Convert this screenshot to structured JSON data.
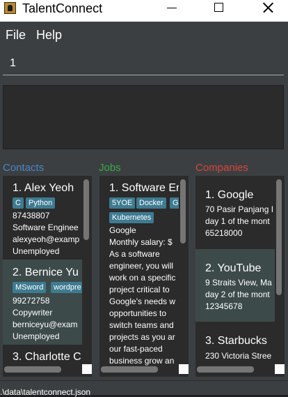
{
  "window": {
    "title": "TalentConnect",
    "controls": [
      "minimize-icon",
      "maximize-icon",
      "close-icon"
    ]
  },
  "menu": {
    "file": "File",
    "help": "Help"
  },
  "command": {
    "value": "1"
  },
  "panels": {
    "contacts": {
      "label": "Contacts",
      "color": "#4a86c8"
    },
    "jobs": {
      "label": "Jobs",
      "color": "#3ca84a"
    },
    "companies": {
      "label": "Companies",
      "color": "#d9453d"
    }
  },
  "contacts": [
    {
      "title": "1. Alex Yeoh",
      "tags": [
        "C",
        "Python"
      ],
      "phone": "87438807",
      "role": "Software Enginee",
      "email": "alexyeoh@examp",
      "status": "Unemployed"
    },
    {
      "title": "2. Bernice Yu",
      "tags": [
        "MSword",
        "wordpre"
      ],
      "phone": "99272758",
      "role": "Copywriter",
      "email": "berniceyu@exam",
      "status": "Unemployed"
    },
    {
      "title": "3. Charlotte C"
    }
  ],
  "jobs": [
    {
      "title": "1. Software Er",
      "tags": [
        "5YOE",
        "Docker",
        "G",
        "Kubernetes"
      ],
      "company": "Google",
      "salary": "Monthly salary: $",
      "desc": [
        "As a software",
        "engineer, you will",
        "work on a specific",
        "project critical to",
        "Google's needs w",
        "opportunities to",
        "switch teams and",
        "projects as you ar",
        "our fast-paced",
        "business grow an"
      ]
    }
  ],
  "companies": [
    {
      "title": "1. Google",
      "address": "70 Pasir Panjang I",
      "schedule": "day 1 of the mont",
      "phone": "65218000"
    },
    {
      "title": "2. YouTube",
      "address": "9 Straits View, Ma",
      "schedule": "day 2 of the mont",
      "phone": "12345678"
    },
    {
      "title": "3. Starbucks",
      "address": "230 Victoria Stree"
    }
  ],
  "status": {
    "path": ".\\data\\talentconnect.json"
  }
}
